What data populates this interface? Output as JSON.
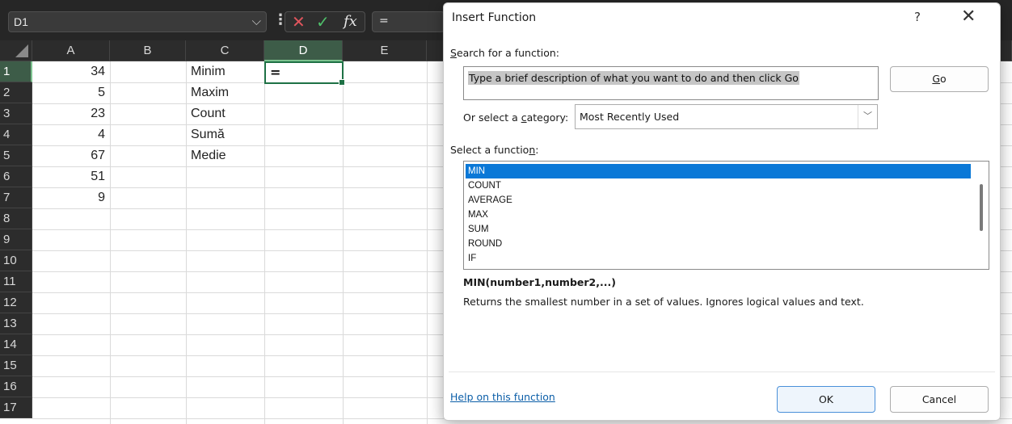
{
  "formula_bar": {
    "name_box": "D1",
    "name_box_chevron_icon": "chevron-down-icon",
    "more_icon": "vertical-dots-icon",
    "cancel_icon": "cancel-x-icon",
    "enter_icon": "checkmark-icon",
    "fx_label": "fx",
    "content": "="
  },
  "grid": {
    "columns": [
      "A",
      "B",
      "C",
      "D",
      "E"
    ],
    "selected_column": "D",
    "selected_row": "1",
    "rows": [
      "1",
      "2",
      "3",
      "4",
      "5",
      "6",
      "7",
      "8",
      "9",
      "10",
      "11",
      "12",
      "13",
      "14",
      "15",
      "16",
      "17"
    ],
    "column_a": [
      "34",
      "5",
      "23",
      "4",
      "67",
      "51",
      "9"
    ],
    "column_c": [
      "Minim",
      "Maxim",
      "Count",
      "Sumă",
      "Medie"
    ],
    "active_cell_value": "="
  },
  "dialog": {
    "title": "Insert Function",
    "help_icon": "?",
    "close_icon": "✕",
    "search_label_accel": "S",
    "search_label_rest": "earch for a function:",
    "search_value": "Type a brief description of what you want to do and then click Go",
    "go_accel": "G",
    "go_rest": "o",
    "category_label_pre": "Or select a ",
    "category_label_accel": "c",
    "category_label_post": "ategory:",
    "category_value": "Most Recently Used",
    "select_fn_label_pre": "Select a functio",
    "select_fn_label_accel": "n",
    "select_fn_label_post": ":",
    "functions": [
      "MIN",
      "COUNT",
      "AVERAGE",
      "MAX",
      "SUM",
      "ROUND",
      "IF"
    ],
    "selected_function": "MIN",
    "signature": "MIN(number1,number2,...)",
    "description": "Returns the smallest number in a set of values. Ignores logical values and text.",
    "help_link": "Help on this function",
    "ok_label": "OK",
    "cancel_label": "Cancel"
  },
  "colors": {
    "selection_blue": "#0a78d7",
    "active_cell_border": "#1e7145",
    "cancel_red": "#e0555d",
    "enter_green": "#4fbf6a"
  }
}
